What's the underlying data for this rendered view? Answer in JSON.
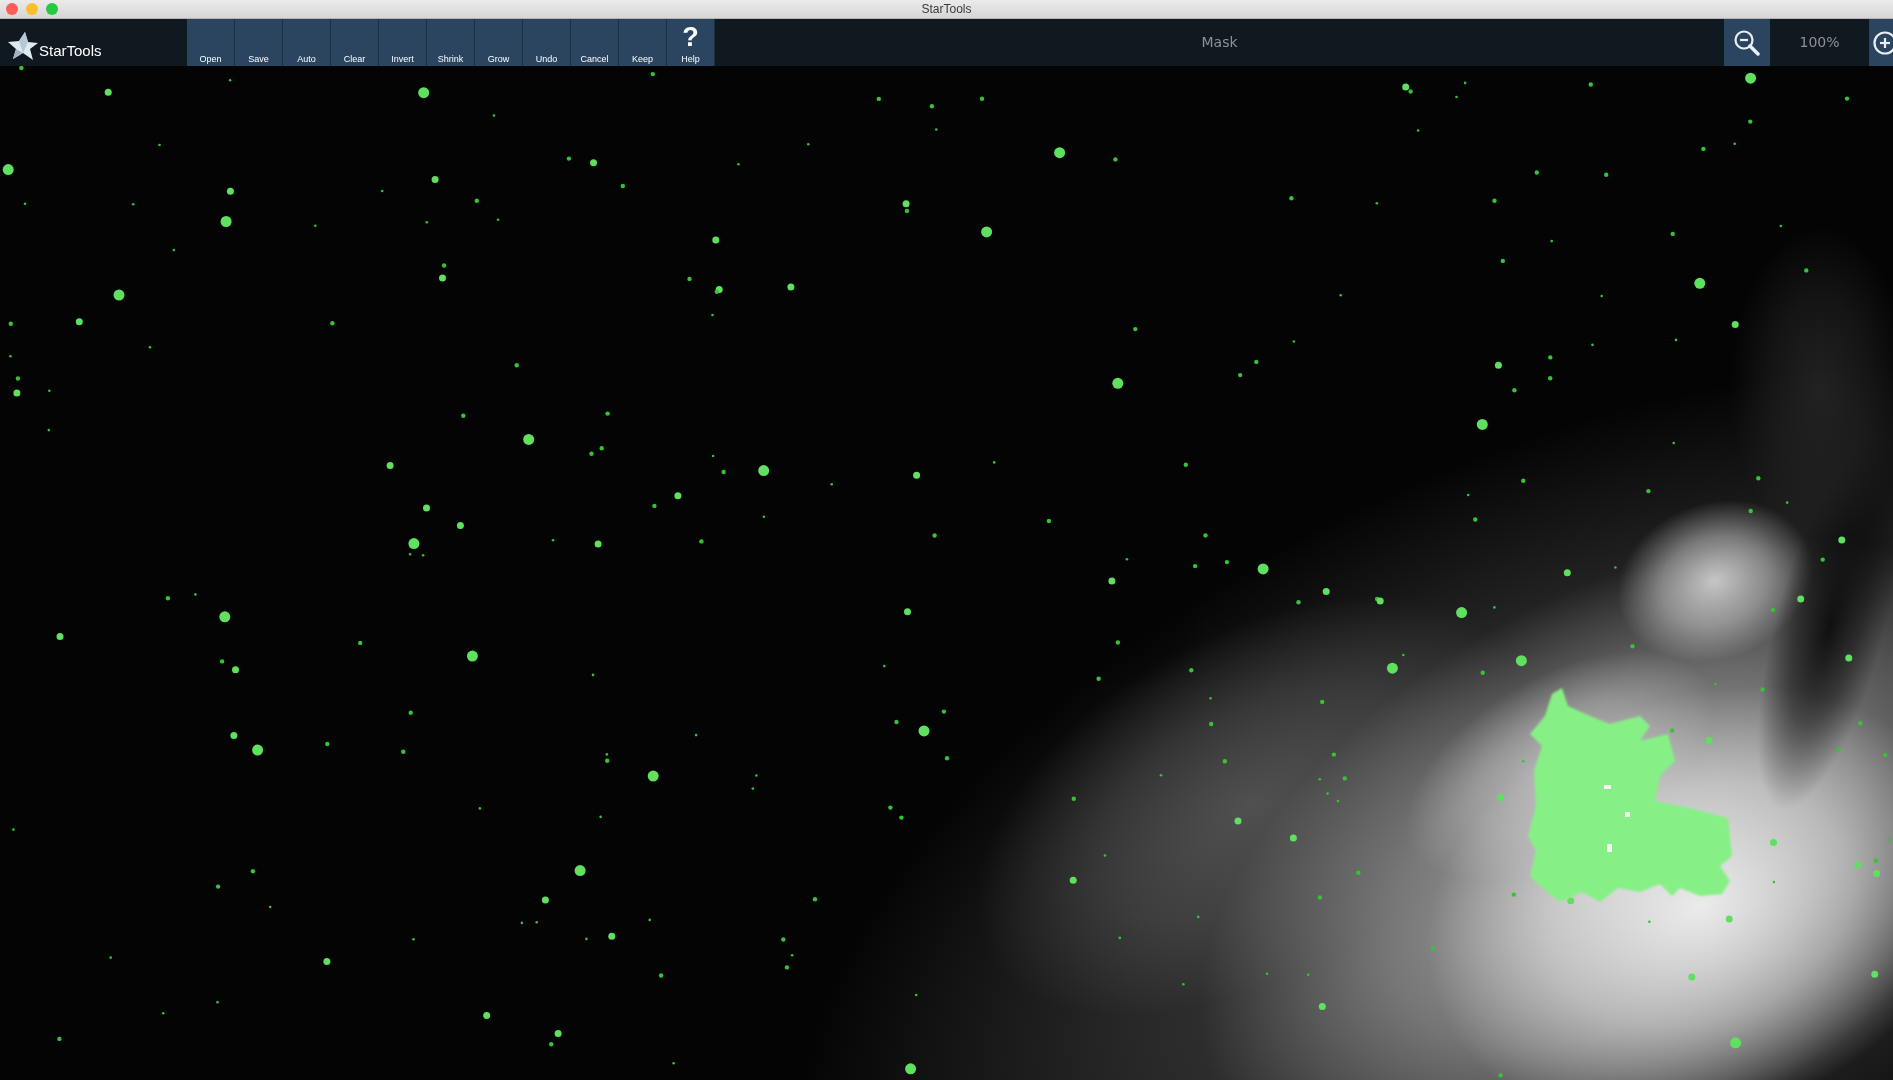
{
  "window": {
    "title": "StarTools"
  },
  "toolbar": {
    "logo_text": "StarTools",
    "buttons": [
      {
        "label": "Open"
      },
      {
        "label": "Save"
      },
      {
        "label": "Auto"
      },
      {
        "label": "Clear"
      },
      {
        "label": "Invert"
      },
      {
        "label": "Shrink"
      },
      {
        "label": "Grow"
      },
      {
        "label": "Undo"
      },
      {
        "label": "Cancel"
      },
      {
        "label": "Keep"
      },
      {
        "label": "Help",
        "icon": "?"
      }
    ],
    "module_title": "Mask",
    "zoom_level": "100%"
  }
}
